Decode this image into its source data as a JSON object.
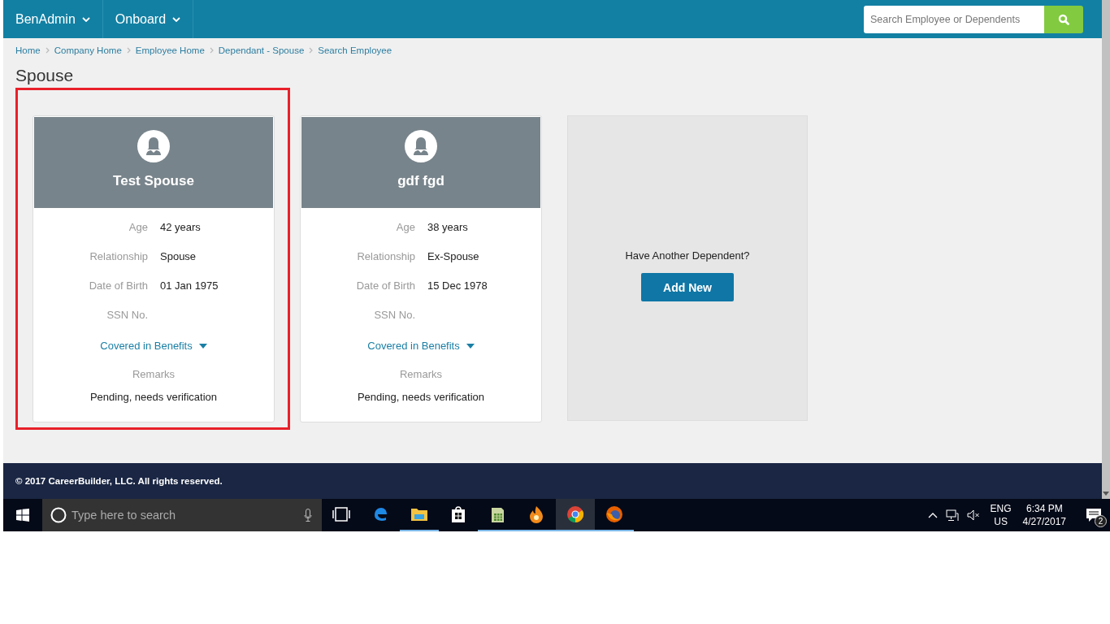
{
  "navbar": {
    "menus": [
      {
        "label": "BenAdmin"
      },
      {
        "label": "Onboard"
      }
    ],
    "search": {
      "placeholder": "Search Employee or Dependents"
    }
  },
  "breadcrumb": [
    "Home",
    "Company Home",
    "Employee Home",
    "Dependant - Spouse",
    "Search Employee"
  ],
  "page_title": "Spouse",
  "cards": [
    {
      "name": "Test Spouse",
      "highlighted": true,
      "fields": [
        {
          "label": "Age",
          "value": "42 years"
        },
        {
          "label": "Relationship",
          "value": "Spouse"
        },
        {
          "label": "Date of Birth",
          "value": "01 Jan 1975"
        },
        {
          "label": "SSN No."
        }
      ],
      "benefits_link": "Covered in Benefits",
      "remarks_label": "Remarks",
      "remarks": "Pending, needs verification"
    },
    {
      "name": "gdf fgd",
      "highlighted": false,
      "fields": [
        {
          "label": "Age",
          "value": "38 years"
        },
        {
          "label": "Relationship",
          "value": "Ex-Spouse"
        },
        {
          "label": "Date of Birth",
          "value": "15 Dec 1978"
        },
        {
          "label": "SSN No."
        }
      ],
      "benefits_link": "Covered in Benefits",
      "remarks_label": "Remarks",
      "remarks": "Pending, needs verification"
    }
  ],
  "add_card": {
    "prompt": "Have Another Dependent?",
    "button": "Add New"
  },
  "footer": "© 2017 CareerBuilder, LLC. All rights reserved.",
  "taskbar": {
    "search_placeholder": "Type here to search",
    "apps": [
      {
        "kind": "taskview",
        "running": false,
        "selected": false
      },
      {
        "kind": "edge",
        "running": false,
        "selected": false
      },
      {
        "kind": "explorer",
        "running": true,
        "selected": false
      },
      {
        "kind": "store",
        "running": false,
        "selected": false
      },
      {
        "kind": "sheet",
        "running": true,
        "selected": false
      },
      {
        "kind": "flame",
        "running": true,
        "selected": false
      },
      {
        "kind": "chrome",
        "running": true,
        "selected": true
      },
      {
        "kind": "firefox",
        "running": true,
        "selected": false
      }
    ],
    "language": "ENG",
    "region": "US",
    "time": "6:34 PM",
    "date": "4/27/2017",
    "notifications": "2"
  }
}
